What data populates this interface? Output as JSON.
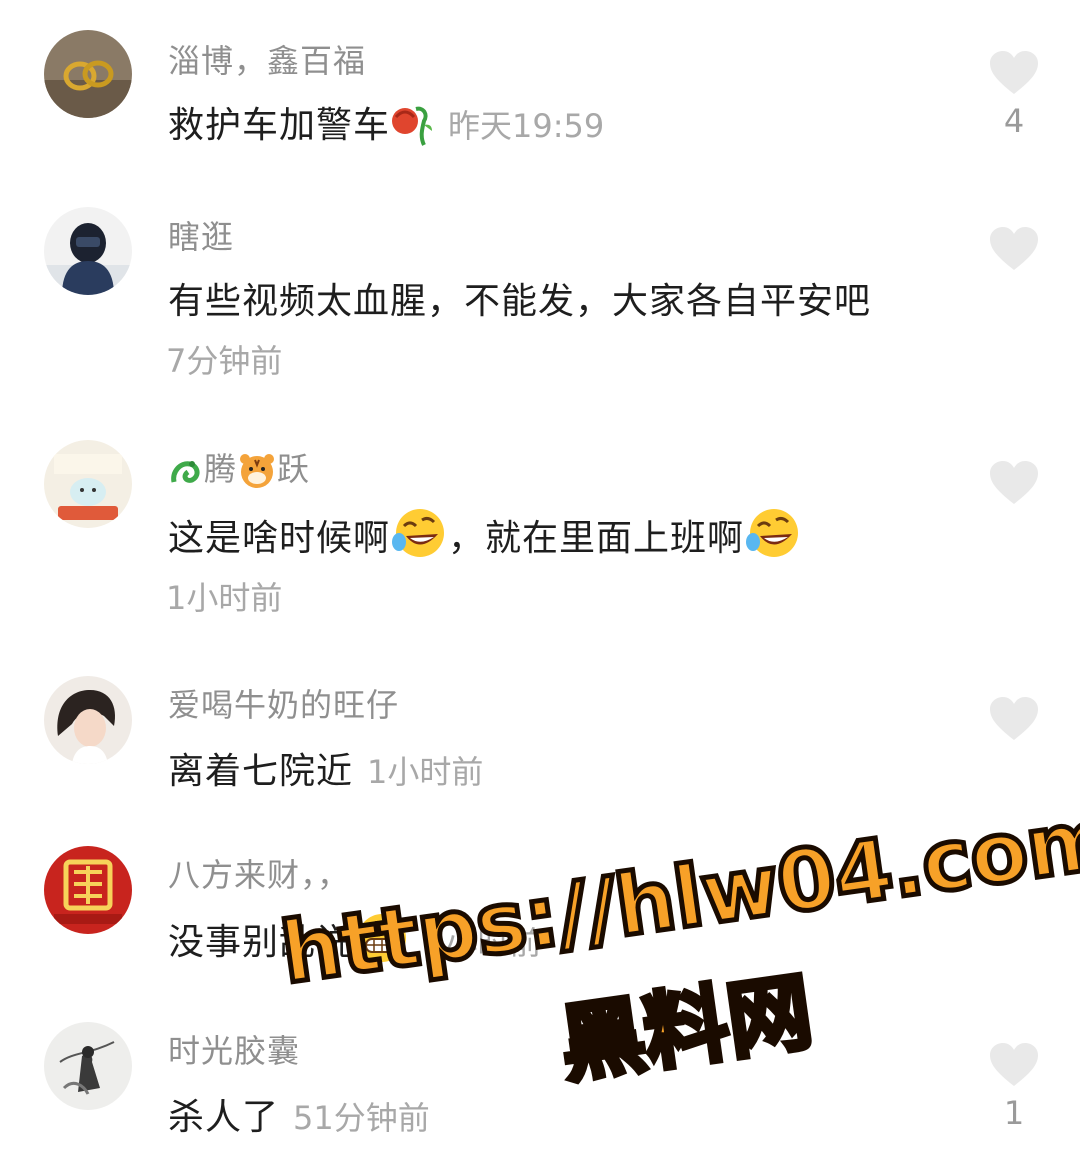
{
  "comments": [
    {
      "username": "淄博，鑫百福",
      "text": "救护车加警车",
      "time": "昨天19:59",
      "like_count": "4",
      "emoji": "wilted-rose"
    },
    {
      "username": "瞎逛",
      "text": "有些视频太血腥，不能发，大家各自平安吧",
      "time": "7分钟前",
      "like_count": ""
    },
    {
      "username_left": "腾",
      "username_right": "跃",
      "username_emojis": [
        "dragon",
        "tiger"
      ],
      "text_part1": "这是啥时候啊",
      "text_part2": "，就在里面上班啊",
      "emoji": "rolling-laughing",
      "time": "1小时前",
      "like_count": ""
    },
    {
      "username": "爱喝牛奶的旺仔",
      "text": "离着七院近",
      "time": "1小时前",
      "like_count": ""
    },
    {
      "username": "八方来财，，",
      "text": "没事别乱说",
      "emoji": "grinning",
      "time": "1小时前",
      "like_count": ""
    },
    {
      "username": "时光胶囊",
      "text": "杀人了",
      "time": "51分钟前",
      "like_count": "1"
    }
  ],
  "watermark": {
    "url": "https://hlw04.com",
    "name": "黑料网"
  },
  "colors": {
    "username": "#8f8f8f",
    "text": "#1e1e1e",
    "time": "#a8a8a8",
    "like_icon": "#e9e9e9",
    "watermark_fill": "#f7a128"
  }
}
